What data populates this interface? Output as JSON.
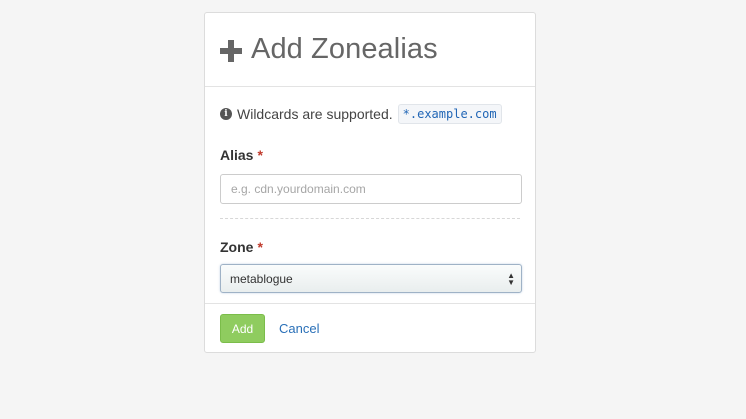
{
  "header": {
    "title": "Add Zonealias"
  },
  "hint": {
    "text": "Wildcards are supported.",
    "code": "*.example.com"
  },
  "alias": {
    "label": "Alias",
    "required_mark": "*",
    "placeholder": "e.g. cdn.yourdomain.com",
    "value": ""
  },
  "zone": {
    "label": "Zone",
    "required_mark": "*",
    "selected": "metablogue"
  },
  "footer": {
    "add_label": "Add",
    "cancel_label": "Cancel"
  },
  "colors": {
    "add_button": "#8fcc5f",
    "link": "#2a70b8",
    "required": "#c0392b"
  },
  "icons": {
    "title": "plus-icon",
    "hint": "info-icon",
    "select": "updown-icon"
  }
}
